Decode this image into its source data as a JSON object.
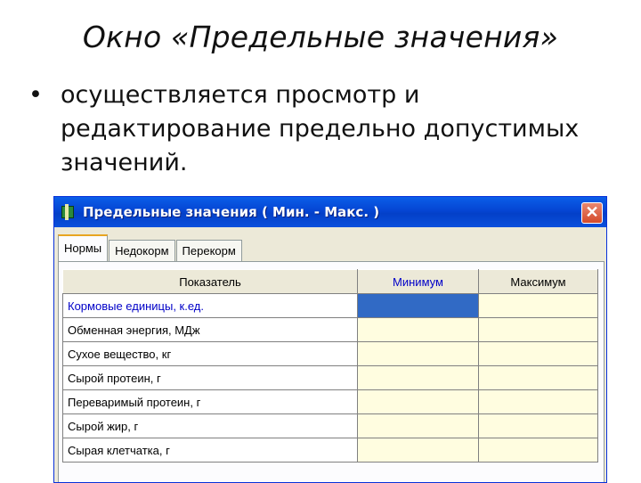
{
  "slide": {
    "title": "Окно «Предельные значения»",
    "bullet": "осуществляется просмотр и\nредактирование предельно допустимых\nзначений."
  },
  "window": {
    "title": "Предельные значения ( Мин. - Макс. )",
    "close_glyph": "✕",
    "tabs": [
      {
        "label": "Нормы",
        "active": true
      },
      {
        "label": "Недокорм",
        "active": false
      },
      {
        "label": "Перекорм",
        "active": false
      }
    ],
    "table": {
      "headers": [
        "Показатель",
        "Минимум",
        "Максимум"
      ],
      "rows": [
        {
          "label": "Кормовые единицы, к.ед.",
          "min": "",
          "max": ""
        },
        {
          "label": "Обменная энергия, МДж",
          "min": "",
          "max": ""
        },
        {
          "label": "Сухое вещество, кг",
          "min": "",
          "max": ""
        },
        {
          "label": "Сырой протеин, г",
          "min": "",
          "max": ""
        },
        {
          "label": "Переваримый протеин, г",
          "min": "",
          "max": ""
        },
        {
          "label": "Сырой жир, г",
          "min": "",
          "max": ""
        },
        {
          "label": "Сырая клетчатка, г",
          "min": "",
          "max": ""
        }
      ]
    }
  },
  "colors": {
    "titlebar": "#0545d3",
    "selected_cell": "#316ac5",
    "value_cell": "#fffde0",
    "highlight_text": "#0000c8"
  }
}
